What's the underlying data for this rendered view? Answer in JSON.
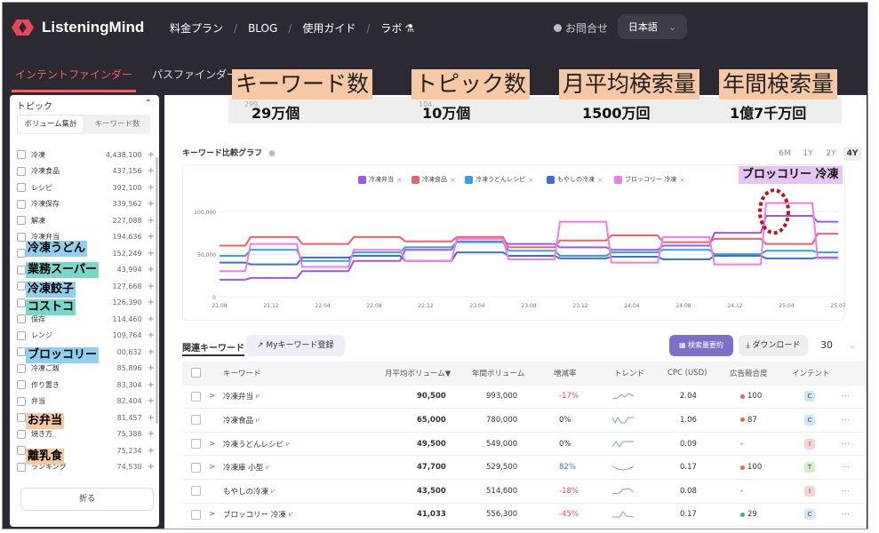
{
  "header": {
    "logo_text": "ListeningMind",
    "nav": [
      "料金プラン",
      "BLOG",
      "使用ガイド",
      "ラボ"
    ],
    "lab_icon": "flask-icon",
    "contact": "お問合せ",
    "language": "日本語"
  },
  "tabs": {
    "active": "インテントファインダー",
    "other": "パスファインダー"
  },
  "sidebar": {
    "title": "トピック",
    "toggle": [
      "ボリューム集計",
      "キーワード数"
    ],
    "items": [
      {
        "name": "冷凍",
        "count": "4,438,100"
      },
      {
        "name": "冷凍食品",
        "count": "437,156"
      },
      {
        "name": "レシピ",
        "count": "392,100"
      },
      {
        "name": "冷凍保存",
        "count": "339,562"
      },
      {
        "name": "解凍",
        "count": "227,088"
      },
      {
        "name": "冷凍弁当",
        "count": "194,636"
      },
      {
        "name": "",
        "count": "152,249"
      },
      {
        "name": "",
        "count": "43,994"
      },
      {
        "name": "",
        "count": "127,668"
      },
      {
        "name": "",
        "count": "126,390"
      },
      {
        "name": "保存",
        "count": "114,460"
      },
      {
        "name": "レンジ",
        "count": "109,764"
      },
      {
        "name": "",
        "count": "00,632"
      },
      {
        "name": "冷凍ご飯",
        "count": "85,896"
      },
      {
        "name": "作り置き",
        "count": "83,304"
      },
      {
        "name": "弁当",
        "count": "82,404"
      },
      {
        "name": "",
        "count": "81,457"
      },
      {
        "name": "焼き方",
        "count": "75,388"
      },
      {
        "name": "",
        "count": "75,234"
      },
      {
        "name": "ランキング",
        "count": "74,530"
      }
    ],
    "fold": "折る",
    "annotations": [
      "冷凍うどん",
      "業務スーパー",
      "冷凍餃子",
      "コストコ",
      "ブロッコリー",
      "お弁当",
      "離乳食"
    ]
  },
  "stats": [
    {
      "label": "キーワード数",
      "value": "29万個",
      "ghost": "299,"
    },
    {
      "label": "トピック数",
      "value": "10万個",
      "ghost": "104,"
    },
    {
      "label": "月平均検索量",
      "value": "1500万回",
      "ghost": ""
    },
    {
      "label": "年間検索量",
      "value": "1億7千万回",
      "ghost": ""
    }
  ],
  "chart_section": {
    "title": "キーワード比較グラフ",
    "ranges": [
      "6M",
      "1Y",
      "2Y",
      "4Y"
    ],
    "active_range": "4Y",
    "callout": "ブロッコリー 冷凍"
  },
  "chart_data": {
    "type": "line",
    "x": [
      "21.08",
      "21.12",
      "22.04",
      "22.08",
      "22.12",
      "23.04",
      "23.08",
      "23.12",
      "24.04",
      "24.08",
      "24.12",
      "25.04",
      "25.07"
    ],
    "yticks": [
      "0",
      "50,000",
      "100,000"
    ],
    "ylim": [
      0,
      120000
    ],
    "legend_position": "top",
    "series": [
      {
        "name": "冷凍弁当",
        "color": "#9b59e8",
        "values": [
          20000,
          22000,
          30000,
          42000,
          55000,
          65000,
          62000,
          58000,
          55000,
          60000,
          75000,
          95000,
          88000
        ]
      },
      {
        "name": "冷凍食品",
        "color": "#f0606a",
        "values": [
          60000,
          70000,
          62000,
          70000,
          65000,
          70000,
          58000,
          66000,
          72000,
          64000,
          68000,
          62000,
          74000
        ]
      },
      {
        "name": "冷凍うどんレシピ",
        "color": "#3a9ee8",
        "values": [
          48000,
          55000,
          42000,
          52000,
          58000,
          64000,
          54000,
          48000,
          52000,
          55000,
          50000,
          54000,
          52000
        ]
      },
      {
        "name": "もやしの冷凍",
        "color": "#3b6fd9",
        "values": [
          40000,
          38000,
          46000,
          48000,
          42000,
          52000,
          48000,
          45000,
          47000,
          44000,
          48000,
          45000,
          46000
        ]
      },
      {
        "name": "ブロッコリー 冷凍",
        "color": "#f07ce8",
        "values": [
          30000,
          62000,
          35000,
          55000,
          42000,
          68000,
          44000,
          88000,
          40000,
          70000,
          38000,
          110000,
          45000
        ]
      }
    ]
  },
  "related": {
    "title": "関連キーワード",
    "my_keyword": "Myキーワード登録",
    "summary_btn": "検索量要約",
    "download_btn": "ダウンロード",
    "per_page": "30",
    "columns": [
      "キーワード",
      "月平均ボリューム▼",
      "年間ボリューム",
      "増減率",
      "トレンド",
      "CPC (USD)",
      "広告競合度",
      "インテント"
    ],
    "rows": [
      {
        "expand": ">",
        "kw": "冷凍弁当",
        "month": "90,500",
        "year": "993,000",
        "rate": "-17%",
        "rate_type": "neg",
        "cpc": "2.04",
        "comp": "100",
        "comp_color": "#e8684a",
        "intent": "C",
        "intent_color": "#cfe6f7"
      },
      {
        "expand": "",
        "kw": "冷凍食品",
        "month": "65,000",
        "year": "780,000",
        "rate": "0%",
        "rate_type": "zero",
        "cpc": "1.06",
        "comp": "87",
        "comp_color": "#e8684a",
        "intent": "C",
        "intent_color": "#cfe6f7"
      },
      {
        "expand": ">",
        "kw": "冷凍うどんレシピ",
        "month": "49,500",
        "year": "549,000",
        "rate": "0%",
        "rate_type": "zero",
        "cpc": "0.09",
        "comp": "-",
        "comp_color": "",
        "intent": "I",
        "intent_color": "#f8d3d3"
      },
      {
        "expand": ">",
        "kw": "冷凍庫 小型",
        "month": "47,700",
        "year": "529,500",
        "rate": "82%",
        "rate_type": "pos",
        "cpc": "0.17",
        "comp": "100",
        "comp_color": "#e8684a",
        "intent": "T",
        "intent_color": "#d4f0c8"
      },
      {
        "expand": "",
        "kw": "もやしの冷凍",
        "month": "43,500",
        "year": "514,600",
        "rate": "-18%",
        "rate_type": "neg",
        "cpc": "0.08",
        "comp": "-",
        "comp_color": "",
        "intent": "I",
        "intent_color": "#f8d3d3"
      },
      {
        "expand": ">",
        "kw": "ブロッコリー 冷凍",
        "month": "41,033",
        "year": "556,300",
        "rate": "-45%",
        "rate_type": "neg",
        "cpc": "0.17",
        "comp": "29",
        "comp_color": "#3cb371",
        "intent": "C",
        "intent_color": "#cfe6f7"
      }
    ]
  }
}
